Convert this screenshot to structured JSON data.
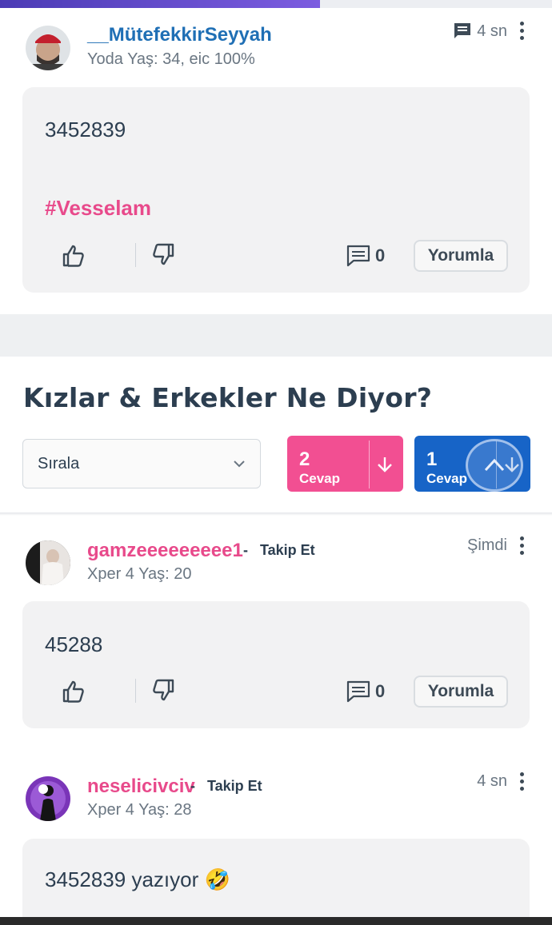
{
  "progress": {
    "fraction": 0.58
  },
  "posts": [
    {
      "username": "__MütefekkirSeyyah",
      "username_color": "#1f6fb5",
      "follow": "",
      "meta": "Yoda  Yaş: 34, eic 100%",
      "time": "4 sn",
      "time_icon": "message-icon",
      "text": "3452839",
      "hashtag": "#Vesselam",
      "comment_count": "0",
      "reply_label": "Yorumla"
    },
    {
      "username": "gamzeeeeeeeee1",
      "username_color": "#e84a8b",
      "follow": "Takip Et",
      "meta": "Xper 4  Yaş: 20",
      "time": "Şimdi",
      "text": "45288",
      "comment_count": "0",
      "reply_label": "Yorumla"
    },
    {
      "username": "neselicivciv",
      "username_color": "#e84a8b",
      "follow": "Takip Et",
      "meta": "Xper 4  Yaş: 28",
      "time": "4 sn",
      "text": "3452839 yazıyor 🤣"
    }
  ],
  "section": {
    "title": "Kızlar & Erkekler Ne Diyor?",
    "sort_label": "Sırala",
    "girls_count": "2",
    "boys_count": "1",
    "count_label": "Cevap",
    "girls_color": "#f24f92",
    "boys_color": "#1764c7"
  }
}
